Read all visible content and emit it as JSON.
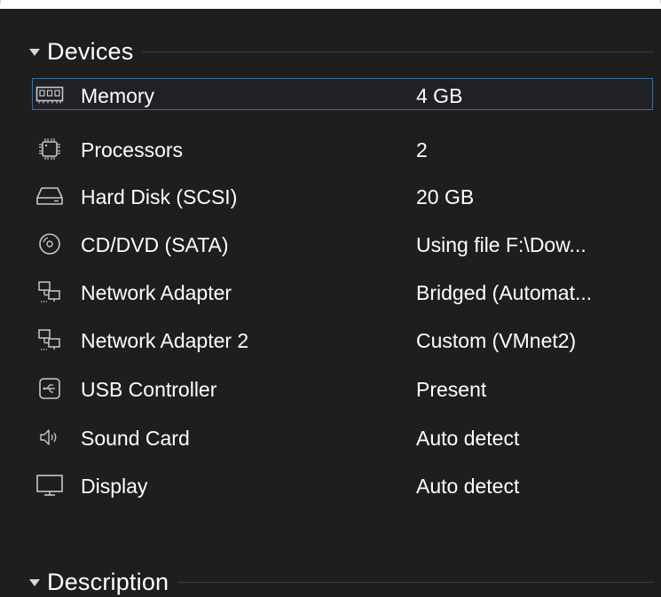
{
  "sections": {
    "devices": {
      "title": "Devices"
    },
    "description": {
      "title": "Description"
    }
  },
  "devices": [
    {
      "icon": "memory-icon",
      "name": "Memory",
      "value": "4 GB",
      "selected": true
    },
    {
      "icon": "processor-icon",
      "name": "Processors",
      "value": "2"
    },
    {
      "icon": "hard-disk-icon",
      "name": "Hard Disk (SCSI)",
      "value": "20 GB"
    },
    {
      "icon": "cd-dvd-icon",
      "name": "CD/DVD (SATA)",
      "value": "Using file F:\\Dow..."
    },
    {
      "icon": "network-adapter-icon",
      "name": "Network Adapter",
      "value": "Bridged (Automat..."
    },
    {
      "icon": "network-adapter-icon",
      "name": "Network Adapter 2",
      "value": "Custom (VMnet2)"
    },
    {
      "icon": "usb-icon",
      "name": "USB Controller",
      "value": "Present"
    },
    {
      "icon": "speaker-icon",
      "name": "Sound Card",
      "value": "Auto detect"
    },
    {
      "icon": "monitor-icon",
      "name": "Display",
      "value": "Auto detect"
    }
  ],
  "colors": {
    "background": "#1e1e1e",
    "selection_border": "#3e6e98",
    "icon_stroke": "#c8c8c8"
  }
}
